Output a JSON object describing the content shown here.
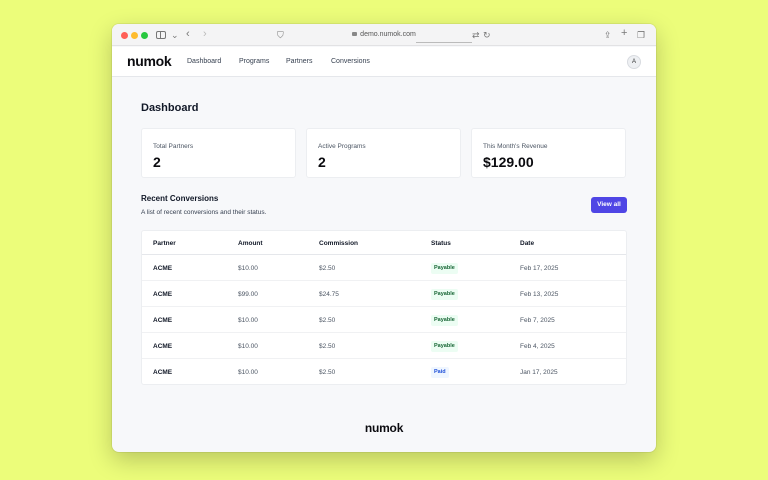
{
  "browser": {
    "url": "demo.numok.com"
  },
  "nav": {
    "logo": "numok",
    "links": [
      "Dashboard",
      "Programs",
      "Partners",
      "Conversions"
    ],
    "avatar_initial": "A"
  },
  "page": {
    "title": "Dashboard"
  },
  "stats": [
    {
      "label": "Total Partners",
      "value": "2"
    },
    {
      "label": "Active Programs",
      "value": "2"
    },
    {
      "label": "This Month's Revenue",
      "value": "$129.00"
    }
  ],
  "conversions": {
    "title": "Recent Conversions",
    "subtitle": "A list of recent conversions and their status.",
    "view_all_label": "View all",
    "columns": [
      "Partner",
      "Amount",
      "Commission",
      "Status",
      "Date"
    ],
    "rows": [
      {
        "partner": "ACME",
        "amount": "$10.00",
        "commission": "$2.50",
        "status": "Payable",
        "date": "Feb 17, 2025"
      },
      {
        "partner": "ACME",
        "amount": "$99.00",
        "commission": "$24.75",
        "status": "Payable",
        "date": "Feb 13, 2025"
      },
      {
        "partner": "ACME",
        "amount": "$10.00",
        "commission": "$2.50",
        "status": "Payable",
        "date": "Feb 7, 2025"
      },
      {
        "partner": "ACME",
        "amount": "$10.00",
        "commission": "$2.50",
        "status": "Payable",
        "date": "Feb 4, 2025"
      },
      {
        "partner": "ACME",
        "amount": "$10.00",
        "commission": "$2.50",
        "status": "Paid",
        "date": "Jan 17, 2025"
      }
    ]
  },
  "footer": {
    "logo": "numok"
  },
  "colors": {
    "background": "#ecfd7a",
    "accent": "#4f46e5",
    "payable_text": "#166534",
    "paid_text": "#1d4ed8"
  }
}
